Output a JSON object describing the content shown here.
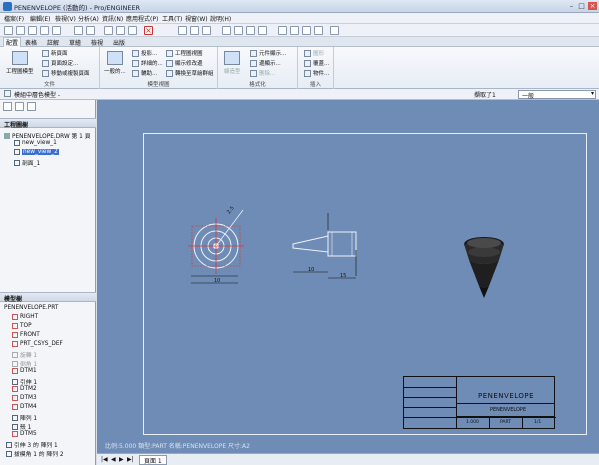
{
  "window": {
    "title": "PENENVELOPE (活動的) - Pro/ENGINEER"
  },
  "menu": [
    "檔案(F)",
    "編輯(E)",
    "檢視(V)",
    "分析(A)",
    "資訊(N)",
    "應用程式(P)",
    "工具(T)",
    "視窗(W)",
    "說明(H)"
  ],
  "tabs": [
    "配置",
    "表格",
    "註解",
    "草繪",
    "檢視",
    "出版"
  ],
  "ribbon": {
    "file_group": {
      "big": "工程圖模型",
      "items": [
        "新頁面",
        "頁面設定...",
        "移動或複製頁面"
      ],
      "label": "文件"
    },
    "model_views": {
      "big": "一般的...",
      "col1": [
        "投影...",
        "詳細的...",
        "輔助..."
      ],
      "col2": [
        "工程圖視圖",
        "顯示修改邊",
        "轉換至草繪群組"
      ],
      "label": "模型視圖"
    },
    "format": {
      "big": "線造型",
      "items": [
        "元件顯示...",
        "邊顯示...",
        "刪除..."
      ],
      "label": "格式化"
    },
    "insert": {
      "items": [
        "圖形",
        "覆蓋...",
        "物件..."
      ],
      "label": "插入"
    }
  },
  "status": {
    "hint": "模組中層色模型 -",
    "selection_label": "擷取了1",
    "filter": "一般"
  },
  "drawing_tree": {
    "header": "工程圖樹",
    "items": [
      "PENENVELOPE.DRW 第 1 頁",
      "new_view_1",
      "new_view_2",
      "剖面_1"
    ]
  },
  "model_tree": {
    "header": "模型樹",
    "items": [
      "PENENVELOPE.PRT",
      "RIGHT",
      "TOP",
      "FRONT",
      "PRT_CSYS_DEF",
      "旋轉 1",
      "倒角 1",
      "DTM1",
      "引伸 1",
      "DTM2",
      "DTM3",
      "DTM4",
      "陣列 1",
      "殼 1",
      "DTM5",
      "引伸 3 的 陣列 1",
      "拔模角 1 的 陣列 2"
    ]
  },
  "title_block": {
    "name": "PENENVELOPE",
    "subname": "PENENVELOPE",
    "scale": "1.000",
    "part": "PART",
    "sheet": "1/1"
  },
  "canvas_footer": "比例:5.000   類型:PART   名稱:PENENVELOPE   尺寸:A2",
  "page_tab": "頁面 1",
  "dims": [
    "10",
    "2.5",
    "6.8",
    "10",
    "15"
  ]
}
